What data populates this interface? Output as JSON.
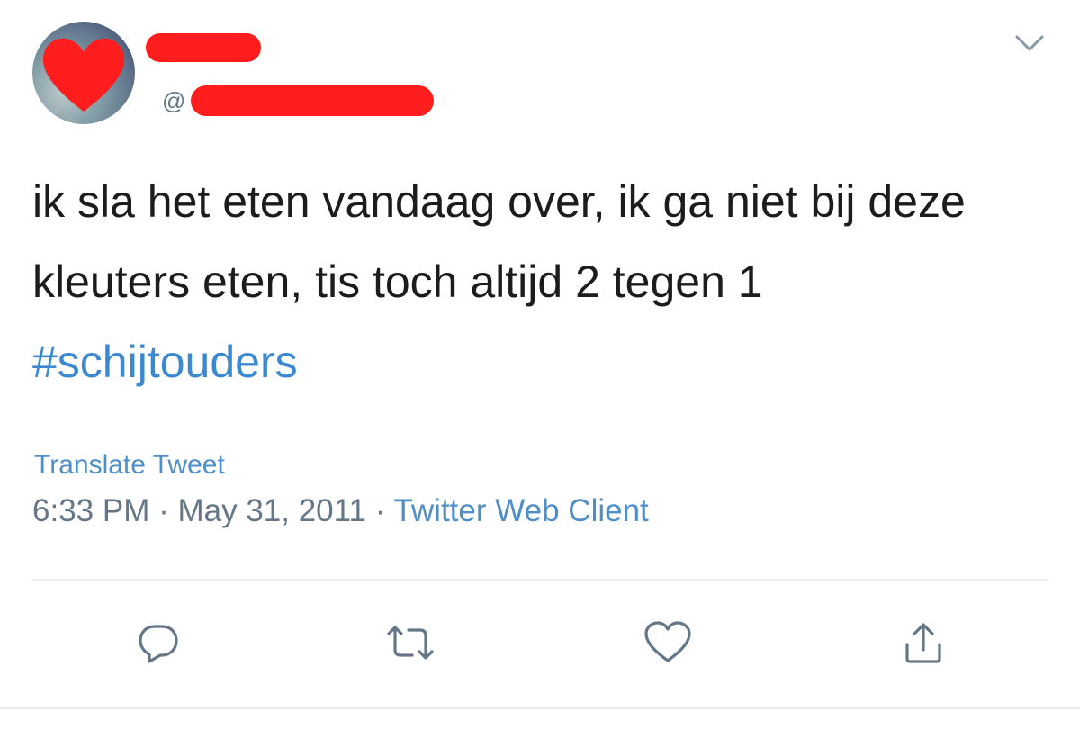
{
  "author": {
    "handle_prefix": "@"
  },
  "tweet": {
    "text_plain": "ik sla het eten vandaag over, ik ga niet bij deze kleuters eten, tis toch altijd 2 tegen 1",
    "hashtag": "#schijtouders",
    "translate_label": "Translate Tweet",
    "time": "6:33 PM",
    "separator": " · ",
    "date": "May 31, 2011",
    "source": "Twitter Web Client"
  },
  "colors": {
    "link": "#4e8fc9",
    "muted": "#657786",
    "redaction": "#ff1d1d"
  },
  "icons": [
    "chevron-down-icon",
    "reply-icon",
    "retweet-icon",
    "like-icon",
    "share-icon"
  ]
}
